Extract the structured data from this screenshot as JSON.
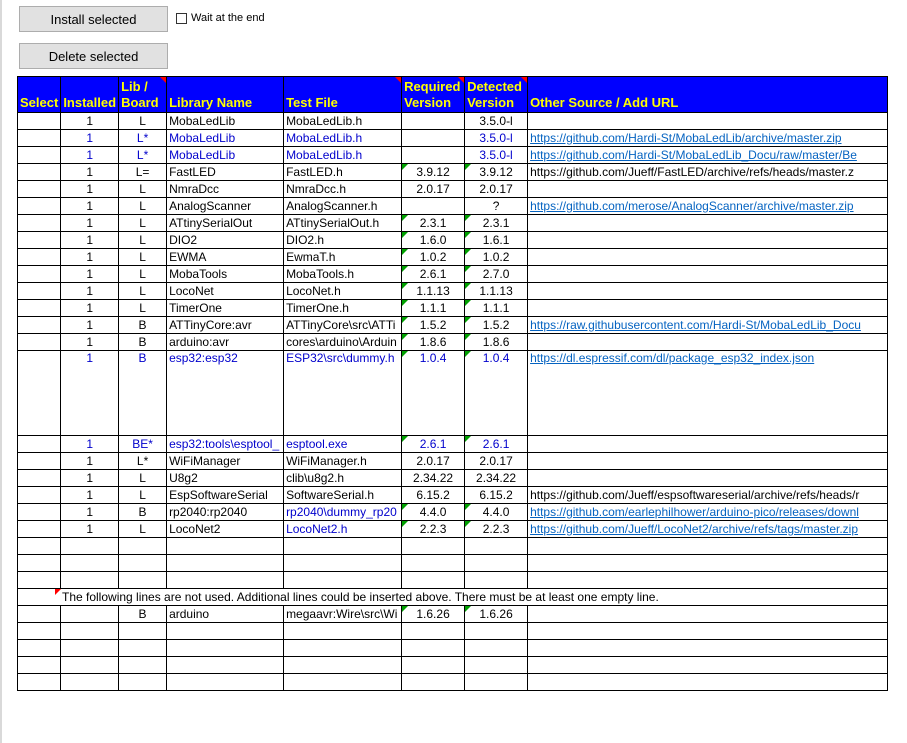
{
  "buttons": {
    "install": "Install selected",
    "delete": "Delete selected"
  },
  "wait_checkbox": {
    "label": "Wait at the end",
    "checked": false
  },
  "headers": [
    "Select",
    "Installed",
    "Lib / Board",
    "Library Name",
    "Test File",
    "Required Version",
    "Detected Version",
    "Other Source / Add URL"
  ],
  "rows": [
    {
      "installed": "1",
      "type": "L",
      "name": "MobaLedLib",
      "test": "MobaLedLib.h",
      "req": "",
      "det": "3.5.0-l",
      "url": "",
      "blue": false,
      "link": false
    },
    {
      "installed": "1",
      "type": "L*",
      "name": "MobaLedLib",
      "test": "MobaLedLib.h",
      "req": "",
      "det": "3.5.0-l",
      "url": "https://github.com/Hardi-St/MobaLedLib/archive/master.zip",
      "blue": true,
      "link": true
    },
    {
      "installed": "1",
      "type": "L*",
      "name": "MobaLedLib",
      "test": "MobaLedLib.h",
      "req": "",
      "det": "3.5.0-l",
      "url": "https://github.com/Hardi-St/MobaLedLib_Docu/raw/master/Be",
      "blue": true,
      "link": true
    },
    {
      "installed": "1",
      "type": "L=",
      "name": "FastLED",
      "test": "FastLED.h",
      "req": "3.9.12",
      "det": "3.9.12",
      "url": "https://github.com/Jueff/FastLED/archive/refs/heads/master.z",
      "blue": false,
      "link": false,
      "gtri": true
    },
    {
      "installed": "1",
      "type": "L",
      "name": "NmraDcc",
      "test": "NmraDcc.h",
      "req": "2.0.17",
      "det": "2.0.17",
      "url": "",
      "blue": false,
      "link": false
    },
    {
      "installed": "1",
      "type": "L",
      "name": "AnalogScanner",
      "test": "AnalogScanner.h",
      "req": "",
      "det": "?",
      "url": "https://github.com/merose/AnalogScanner/archive/master.zip",
      "blue": false,
      "link": true
    },
    {
      "installed": "1",
      "type": "L",
      "name": "ATtinySerialOut",
      "test": "ATtinySerialOut.h",
      "req": "2.3.1",
      "det": "2.3.1",
      "url": "",
      "blue": false,
      "link": false,
      "gtri": true
    },
    {
      "installed": "1",
      "type": "L",
      "name": "DIO2",
      "test": "DIO2.h",
      "req": "1.6.0",
      "det": "1.6.1",
      "url": "",
      "blue": false,
      "link": false,
      "gtri": true
    },
    {
      "installed": "1",
      "type": "L",
      "name": "EWMA",
      "test": "EwmaT.h",
      "req": "1.0.2",
      "det": "1.0.2",
      "url": "",
      "blue": false,
      "link": false,
      "gtri": true
    },
    {
      "installed": "1",
      "type": "L",
      "name": "MobaTools",
      "test": "MobaTools.h",
      "req": "2.6.1",
      "det": "2.7.0",
      "url": "",
      "blue": false,
      "link": false,
      "gtri": true
    },
    {
      "installed": "1",
      "type": "L",
      "name": "LocoNet",
      "test": "LocoNet.h",
      "req": "1.1.13",
      "det": "1.1.13",
      "url": "",
      "blue": false,
      "link": false,
      "gtri": true
    },
    {
      "installed": "1",
      "type": "L",
      "name": "TimerOne",
      "test": "TimerOne.h",
      "req": "1.1.1",
      "det": "1.1.1",
      "url": "",
      "blue": false,
      "link": false,
      "gtri": true
    },
    {
      "installed": "1",
      "type": "B",
      "name": "ATTinyCore:avr",
      "test": "ATTinyCore\\src\\ATTi",
      "req": "1.5.2",
      "det": "1.5.2",
      "url": "https://raw.githubusercontent.com/Hardi-St/MobaLedLib_Docu",
      "blue": false,
      "link": true,
      "gtri": true
    },
    {
      "installed": "1",
      "type": "B",
      "name": "arduino:avr",
      "test": "cores\\arduino\\Arduin",
      "req": "1.8.6",
      "det": "1.8.6",
      "url": "",
      "blue": false,
      "link": false,
      "gtri": true
    },
    {
      "installed": "1",
      "type": "B",
      "name": "esp32:esp32",
      "test": "ESP32\\src\\dummy.h",
      "req": "1.0.4",
      "det": "1.0.4",
      "url": "https://dl.espressif.com/dl/package_esp32_index.json",
      "blue": true,
      "link": true,
      "tall": true,
      "gtri": true
    },
    {
      "installed": "1",
      "type": "BE*",
      "name": "esp32:tools\\esptool_",
      "test": "esptool.exe",
      "req": "2.6.1",
      "det": "2.6.1",
      "url": "",
      "blue": true,
      "link": false,
      "gtri": true
    },
    {
      "installed": "1",
      "type": "L*",
      "name": "WiFiManager",
      "test": "WiFiManager.h",
      "req": "2.0.17",
      "det": "2.0.17",
      "url": "",
      "blue": false,
      "link": false
    },
    {
      "installed": "1",
      "type": "L",
      "name": "U8g2",
      "test": "clib\\u8g2.h",
      "req": "2.34.22",
      "det": "2.34.22",
      "url": "",
      "blue": false,
      "link": false
    },
    {
      "installed": "1",
      "type": "L",
      "name": "EspSoftwareSerial",
      "test": "SoftwareSerial.h",
      "req": "6.15.2",
      "det": "6.15.2",
      "url": "https://github.com/Jueff/espsoftwareserial/archive/refs/heads/r",
      "blue": false,
      "link": false
    },
    {
      "installed": "1",
      "type": "B",
      "name": "rp2040:rp2040",
      "test": "rp2040\\dummy_rp20",
      "req": "4.4.0",
      "det": "4.4.0",
      "url": "https://github.com/earlephilhower/arduino-pico/releases/downl",
      "blue": false,
      "link": true,
      "testblue": true,
      "gtri": true
    },
    {
      "installed": "1",
      "type": "L",
      "name": "LocoNet2",
      "test": "LocoNet2.h",
      "req": "2.2.3",
      "det": "2.2.3",
      "url": "https://github.com/Jueff/LocoNet2/archive/refs/tags/master.zip",
      "blue": false,
      "link": true,
      "testblue": true,
      "gtri": true
    }
  ],
  "note": "The following lines are not used. Additional lines could be inserted above. There must be at least one empty line.",
  "unused_row": {
    "type": "B",
    "name": "arduino",
    "test": "megaavr:Wire\\src\\Wi",
    "req": "1.6.26",
    "det": "1.6.26"
  }
}
